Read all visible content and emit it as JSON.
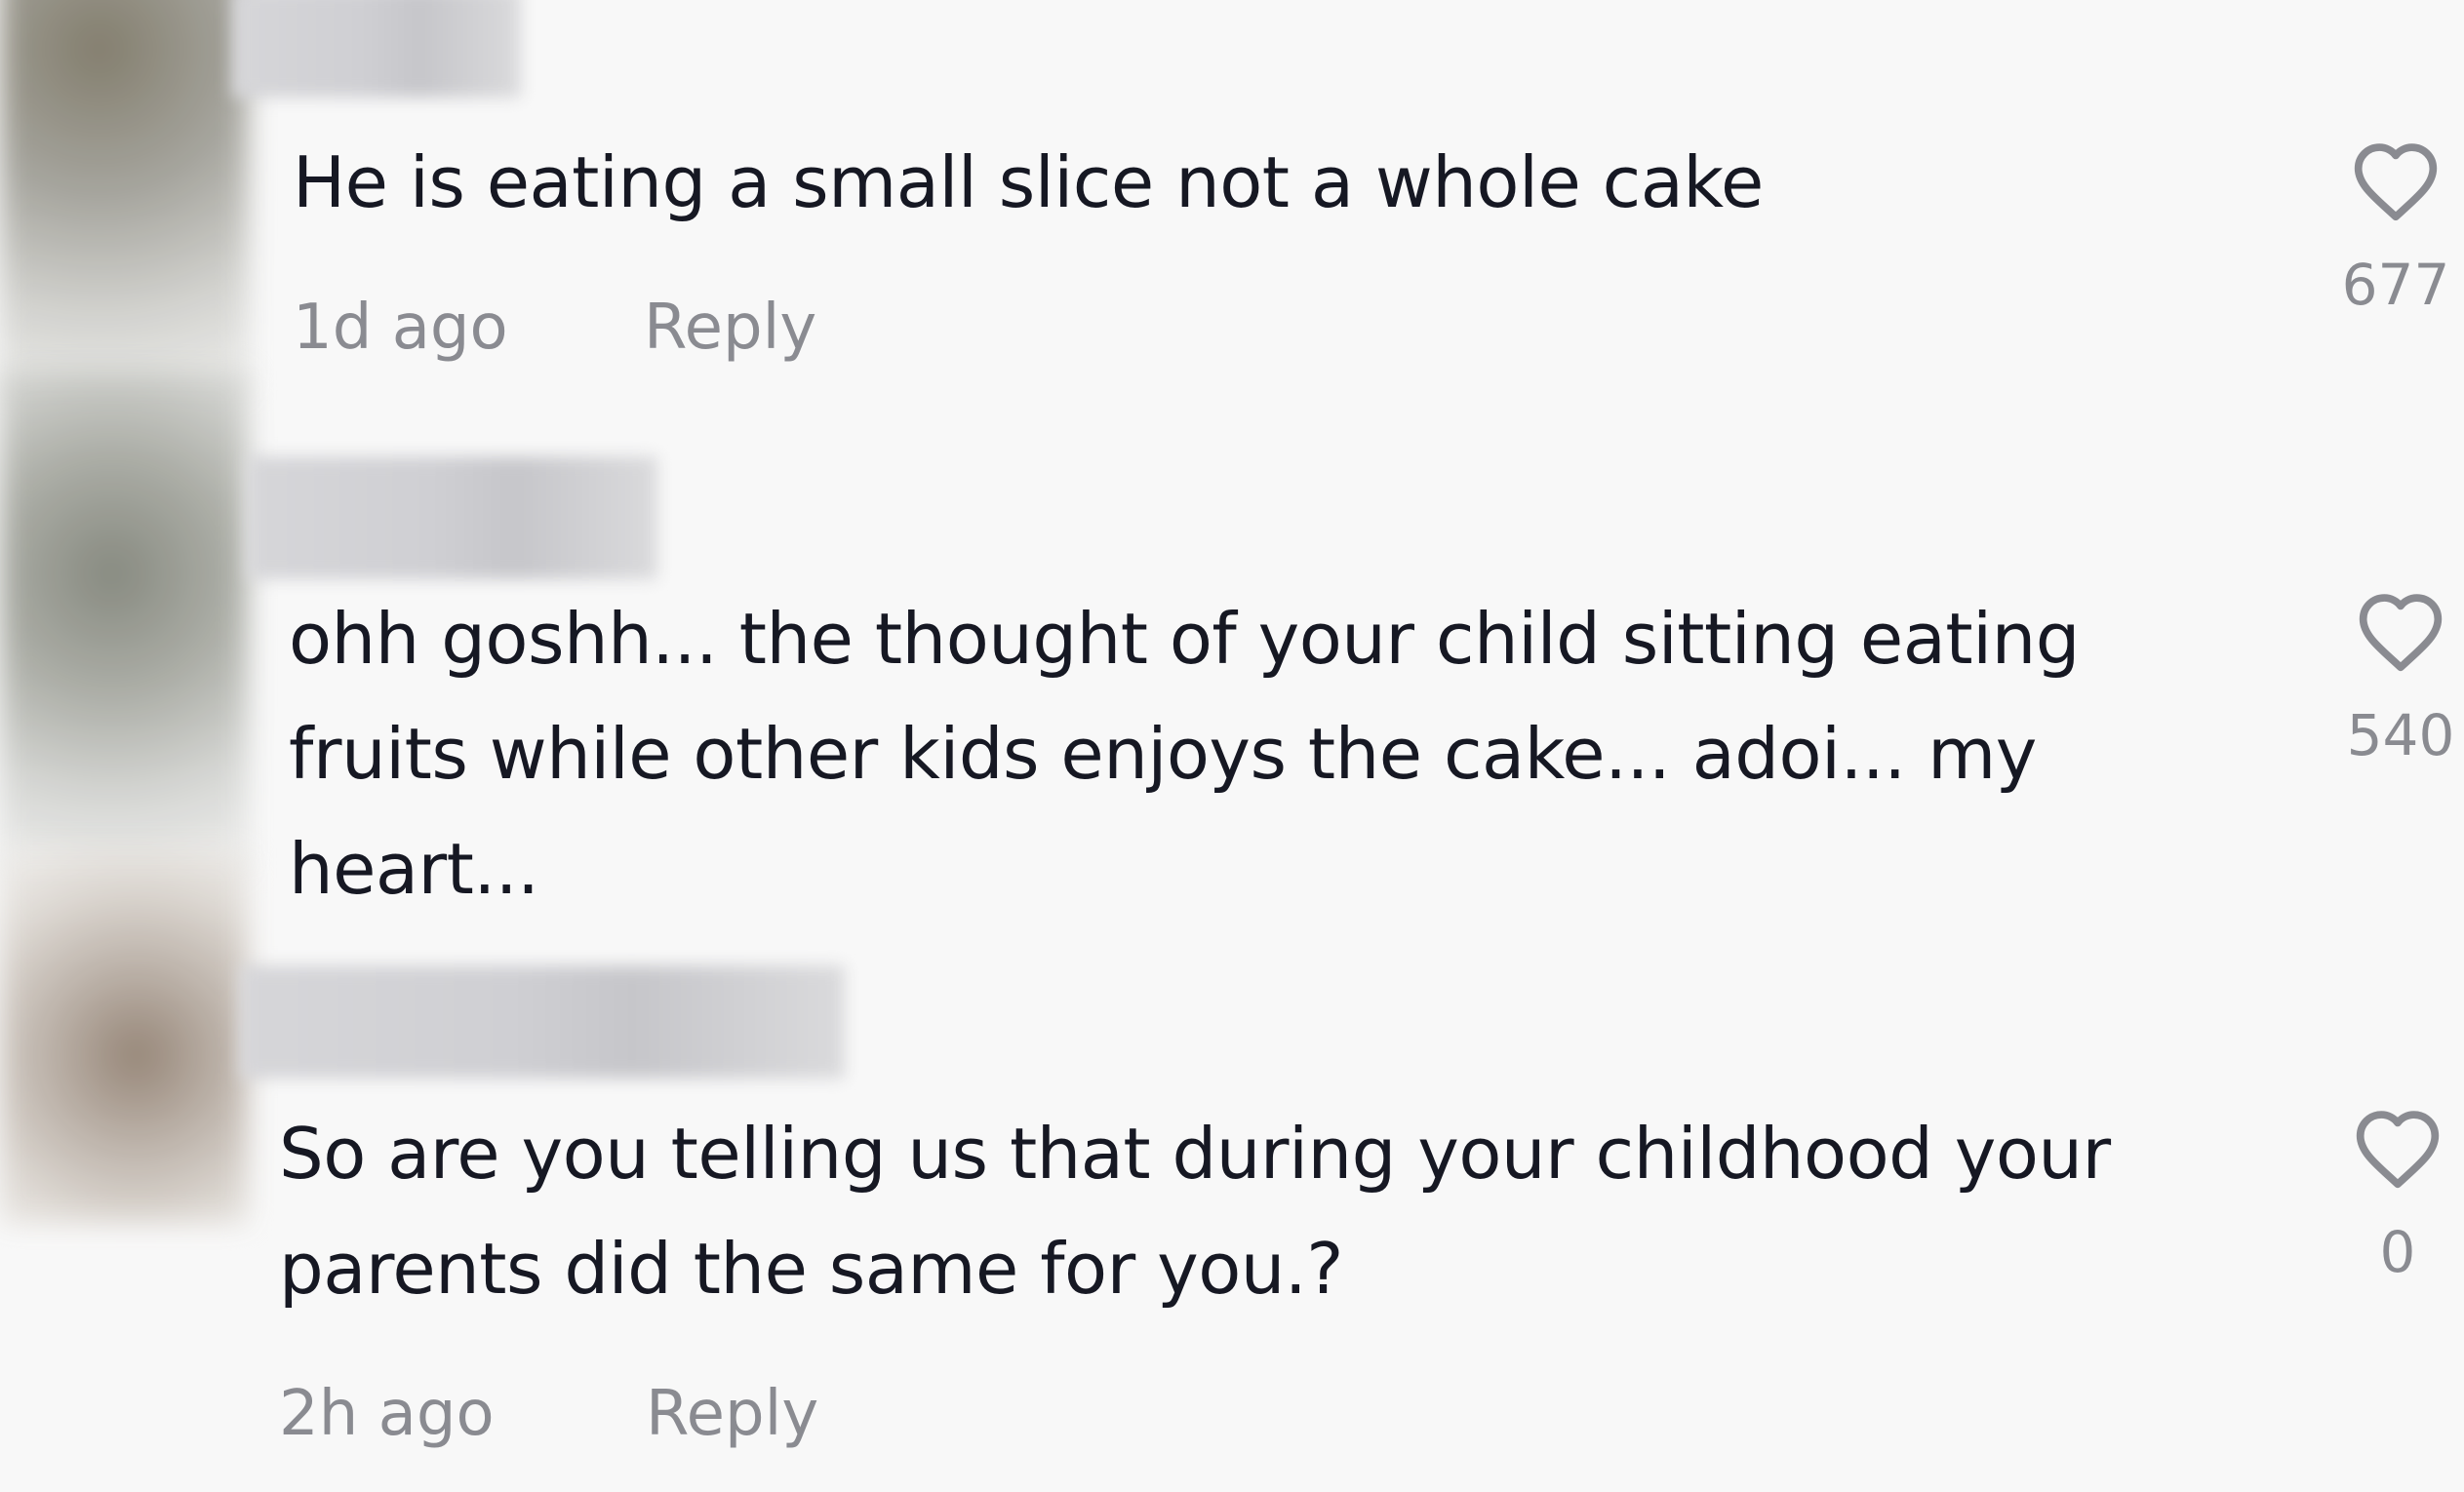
{
  "comments": [
    {
      "text": "He is eating a small slice not a whole cake",
      "time": "1d ago",
      "reply_label": "Reply",
      "likes": "677"
    },
    {
      "text": "ohh goshh... the thought of your child sitting eating fruits while other kids enjoys the cake... adoi... my heart...",
      "likes": "540"
    },
    {
      "text": "So are you telling us that during your childhood your parents did the same for you.?",
      "time": "2h ago",
      "reply_label": "Reply",
      "likes": "0"
    }
  ],
  "icons": {
    "like": "heart-outline-icon"
  },
  "colors": {
    "background": "#f8f8f8",
    "text": "#161823",
    "muted": "#8a8b91",
    "icon": "#8a8b91"
  }
}
